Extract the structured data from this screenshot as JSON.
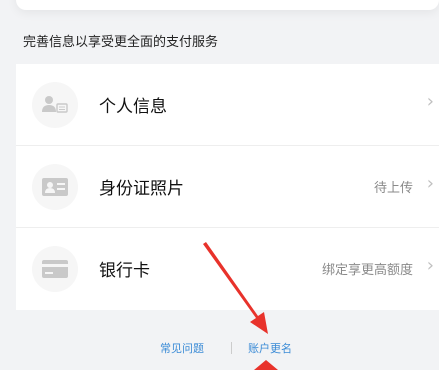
{
  "section_title": "完善信息以享受更全面的支付服务",
  "items": [
    {
      "label": "个人信息",
      "value": "",
      "icon": "person-card-icon"
    },
    {
      "label": "身份证照片",
      "value": "待上传",
      "icon": "id-card-icon"
    },
    {
      "label": "银行卡",
      "value": "绑定享更高额度",
      "icon": "bank-card-icon"
    }
  ],
  "footer": {
    "faq": "常见问题",
    "rename": "账户更名"
  },
  "colors": {
    "background": "#f2f3f5",
    "link": "#3b8bd6",
    "annotation_arrow": "#e8322b"
  }
}
